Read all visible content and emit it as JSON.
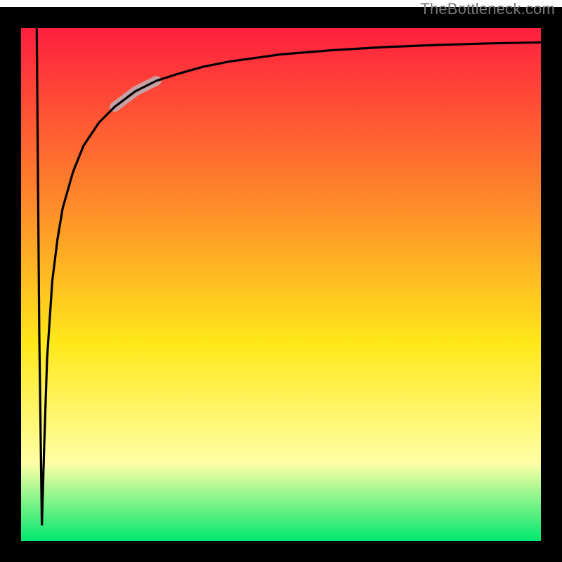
{
  "watermark": "TheBottleneck.com",
  "colors": {
    "border": "#000000",
    "curve": "#000000",
    "highlight": "#c7a2a4",
    "gradient_top": "#ff1a3f",
    "gradient_mid_upper": "#ff8a2a",
    "gradient_mid": "#ffe81a",
    "gradient_mid_lower": "#ffffa5",
    "gradient_bottom": "#00e86f"
  },
  "chart_data": {
    "type": "line",
    "title": "",
    "xlabel": "",
    "ylabel": "",
    "xlim": [
      0,
      100
    ],
    "ylim": [
      0,
      100
    ],
    "grid": false,
    "series": [
      {
        "name": "bottleneck-curve",
        "x": [
          3.0,
          3.5,
          4.0,
          4.5,
          5.0,
          6.0,
          7.0,
          8.0,
          10.0,
          12.0,
          15.0,
          18.0,
          22.0,
          26.0,
          30.0,
          35.0,
          40.0,
          50.0,
          60.0,
          70.0,
          80.0,
          90.0,
          100.0
        ],
        "y": [
          100.0,
          40.0,
          3.0,
          20.0,
          35.0,
          50.0,
          58.0,
          64.0,
          71.0,
          76.0,
          80.5,
          83.5,
          86.5,
          88.5,
          89.8,
          91.2,
          92.2,
          93.6,
          94.4,
          95.0,
          95.4,
          95.7,
          95.9
        ]
      }
    ],
    "highlight_segment": {
      "series": "bottleneck-curve",
      "x_start": 18.0,
      "x_end": 26.0
    },
    "note": "Y values are estimated from the plotted curve against the full-height gradient backdrop; the curve plunges from near the top to a narrow minimum around x≈4 (reaching the green band at the bottom) and then rises asymptotically toward ~96% across the rest of the x range. No axis tick labels are shown in the image."
  }
}
